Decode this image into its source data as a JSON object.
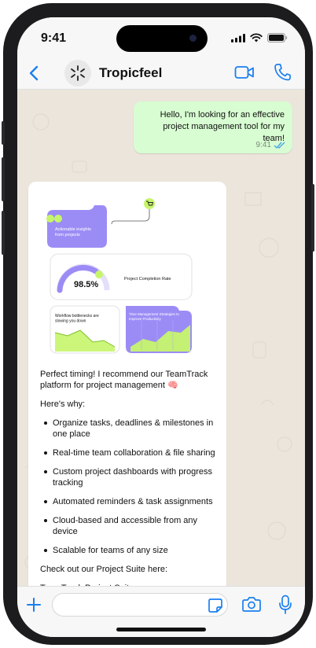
{
  "status": {
    "time": "9:41"
  },
  "header": {
    "contact_name": "Tropicfeel"
  },
  "messages": {
    "outgoing": {
      "text": "Hello, I'm looking for an effective project management tool for my team!",
      "time": "9:41"
    },
    "incoming": {
      "image_card": {
        "insights_label": "Actionable insights from projects",
        "completion_value": "98.5%",
        "completion_label": "Project Completion Rate",
        "bottleneck_label": "Workflow bottlenecks are slowing you down",
        "time_mgmt_label": "Time Management Strategies to Improve Productivity"
      },
      "intro": "Perfect timing! I recommend our TeamTrack platform for project management 🧠",
      "why": "Here's why:",
      "bullets": [
        "Organize tasks, deadlines & milestones in one place",
        "Real-time team collaboration & file sharing",
        "Custom project dashboards with progress tracking",
        "Automated reminders & task assignments",
        "Cloud-based and accessible from any device",
        "Scalable for teams of any size"
      ],
      "cta": "Check out our Project Suite here:",
      "link": "TeamTrack Project Suite"
    }
  },
  "composer": {
    "placeholder": ""
  },
  "colors": {
    "accent": "#1a7ff0",
    "outgoing_bubble": "#d8fdd2",
    "chart_purple": "#9b8cf5",
    "chart_green": "#c6f56b"
  }
}
